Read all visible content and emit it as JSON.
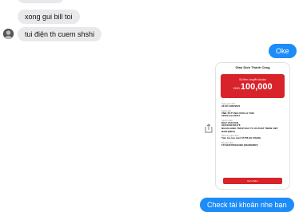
{
  "messages": {
    "incoming": [
      {
        "text": "xong gui bill toi"
      },
      {
        "text": "tui điện th cuem shshi"
      }
    ],
    "outgoing_reply": "Oke",
    "outgoing_partial": "Check tài khoản nhe bạn"
  },
  "receipt": {
    "header": "Giao Dịch Thành Công",
    "subtitle": "Số tiền chuyển khoản",
    "currency": "VND",
    "amount": "100,000",
    "fields": [
      {
        "label": "Ngày giao dịch",
        "value": "16:08 14/06/2021"
      },
      {
        "label": "Người gửi",
        "value": "VND-TGTT-NGUYEN LE TAM\n1900xxxxxx0011"
      },
      {
        "label": "Người nhận",
        "value": "NGO VAN DAN\n52010000455178\nNGAN HANG TMCP DAU TU VA PHAT TRIEN VIET NAM (BIDV)"
      },
      {
        "label": "Nội dung giao dịch",
        "value": "Tien tra cuu card 07758 (IG OSHN)"
      },
      {
        "label": "Mã giao dịch",
        "value": "FT21165766100483 (D1R290857)"
      }
    ],
    "button": "Xem thêm"
  },
  "colors": {
    "bubble_out": "#1d8cf8",
    "bubble_in": "#e9e9eb",
    "brand_red": "#d8232b"
  },
  "icons": {
    "share": "share-icon",
    "avatar": "avatar"
  }
}
